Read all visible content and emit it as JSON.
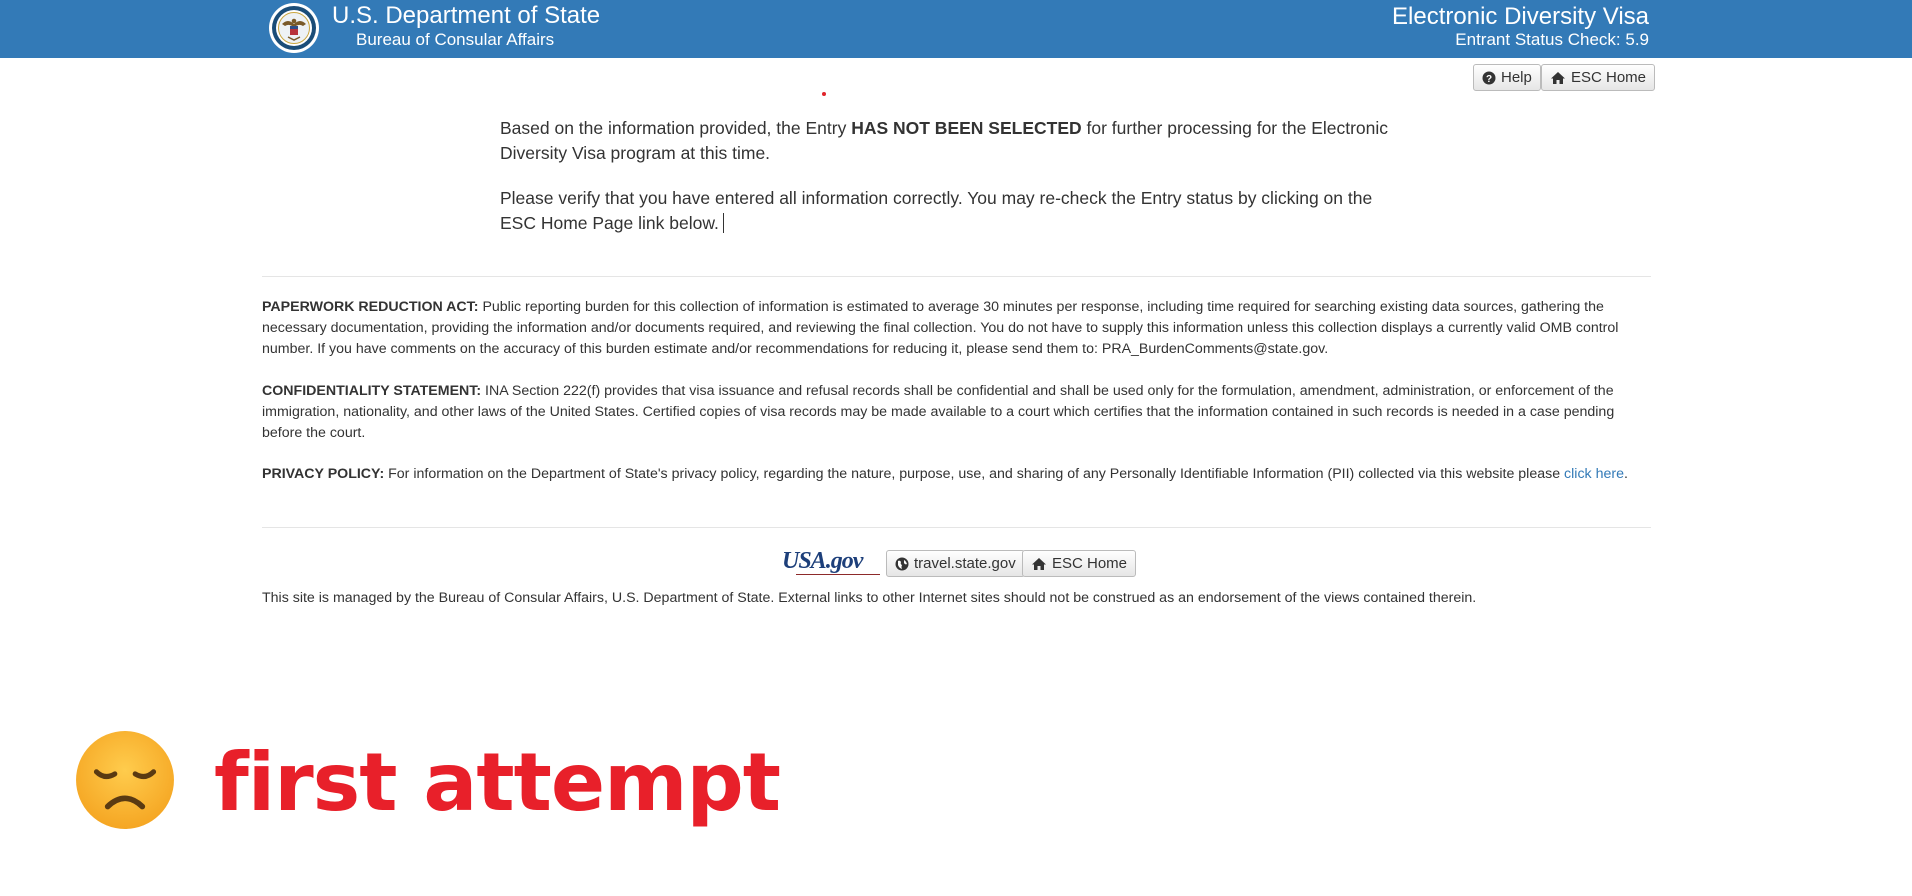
{
  "header": {
    "department": "U.S. Department of State",
    "bureau": "Bureau of Consular Affairs",
    "program": "Electronic Diversity Visa",
    "version": "Entrant Status Check: 5.9"
  },
  "toolbar": {
    "help_label": "Help",
    "esc_home_label": "ESC Home"
  },
  "result": {
    "line1_before": "Based on the information provided, the Entry ",
    "line1_status": "HAS NOT BEEN SELECTED",
    "line1_after": " for further processing for the Electronic Diversity Visa program at this time.",
    "line2": "Please verify that you have entered all information correctly. You may re-check the Entry status by clicking on the ESC Home Page link below."
  },
  "legal": {
    "paperwork_title": "PAPERWORK REDUCTION ACT:",
    "paperwork_text": " Public reporting burden for this collection of information is estimated to average 30 minutes per response, including time required for searching existing data sources, gathering the necessary documentation, providing the information and/or documents required, and reviewing the final collection. You do not have to supply this information unless this collection displays a currently valid OMB control number. If you have comments on the accuracy of this burden estimate and/or recommendations for reducing it, please send them to: PRA_BurdenComments@state.gov.",
    "confidentiality_title": "CONFIDENTIALITY STATEMENT:",
    "confidentiality_text": " INA Section 222(f) provides that visa issuance and refusal records shall be confidential and shall be used only for the formulation, amendment, administration, or enforcement of the immigration, nationality, and other laws of the United States. Certified copies of visa records may be made available to a court which certifies that the information contained in such records is needed in a case pending before the court.",
    "privacy_title": "PRIVACY POLICY:",
    "privacy_text": " For information on the Department of State's privacy policy, regarding the nature, purpose, use, and sharing of any Personally Identifiable Information (PII) collected via this website please ",
    "privacy_link": "click here",
    "privacy_end": "."
  },
  "footer": {
    "usagov_logo": "USA.gov",
    "travel_label": "travel.state.gov",
    "esc_home_label": "ESC Home",
    "disclaimer": "This site is managed by the Bureau of Consular Affairs, U.S. Department of State. External links to other Internet sites should not be construed as an endorsement of the views contained therein."
  },
  "overlay": {
    "emoji": "disappointed-face-icon",
    "caption": "first attempt"
  },
  "colors": {
    "header_bg": "#337ab7",
    "link": "#337ab7",
    "caption": "#e8202a"
  }
}
